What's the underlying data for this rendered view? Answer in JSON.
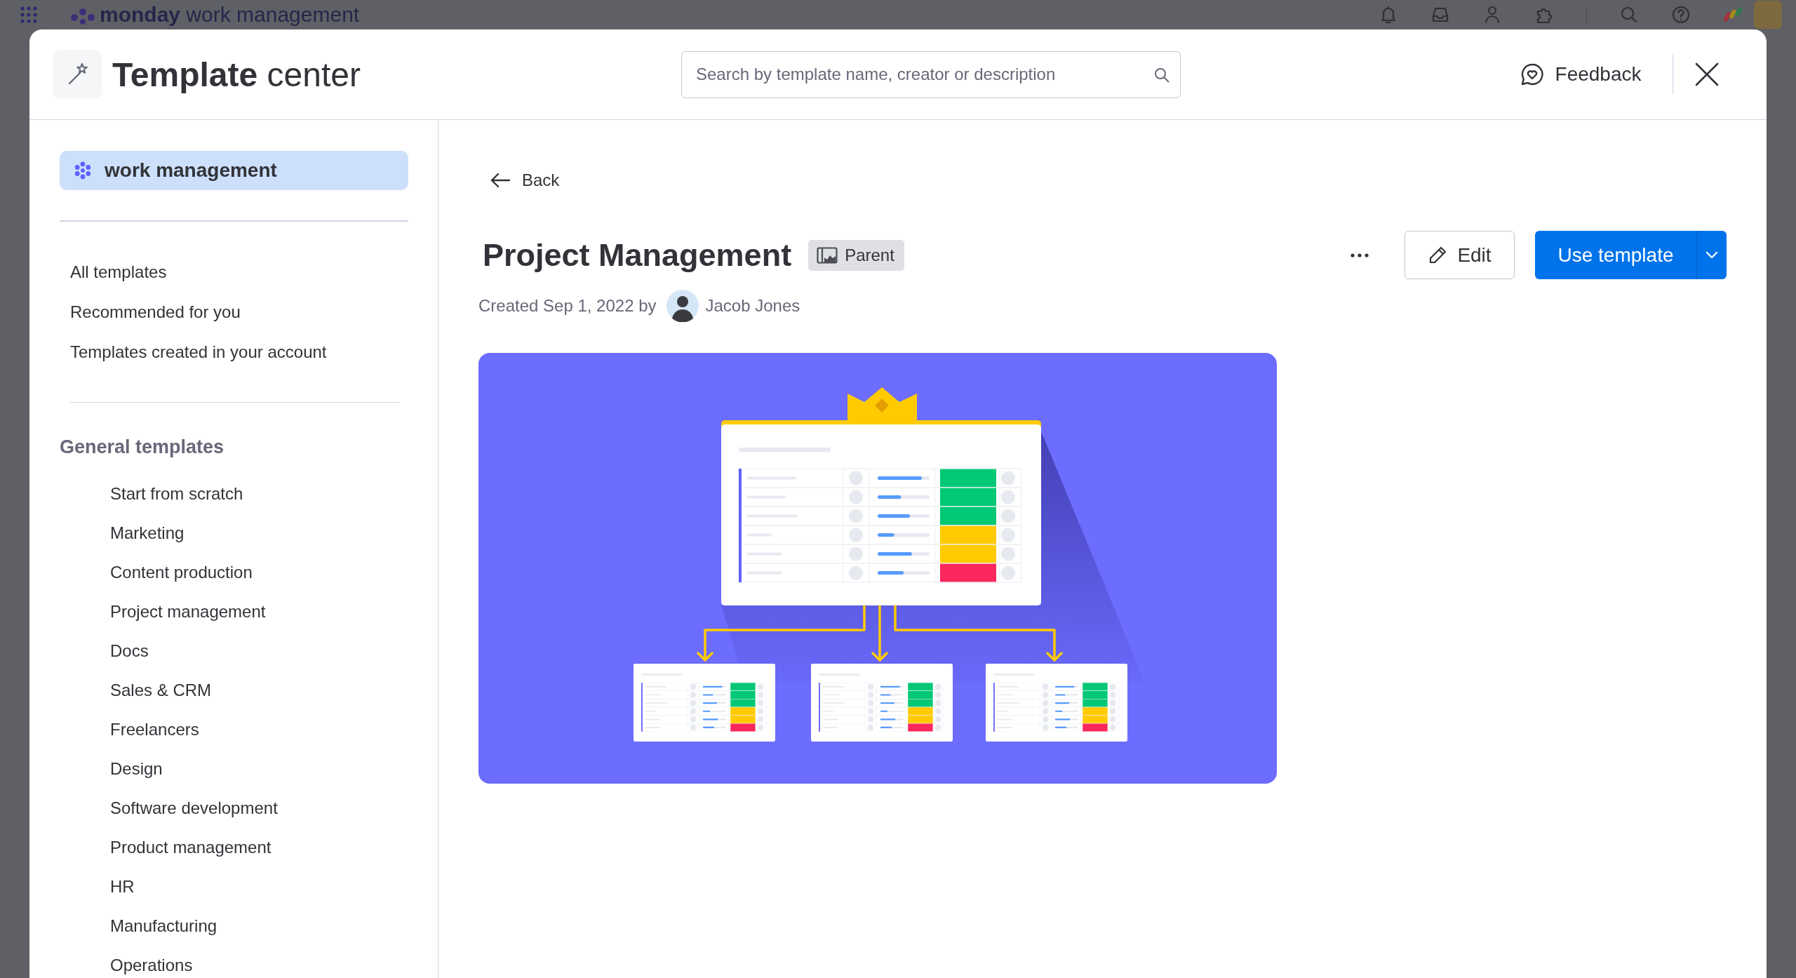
{
  "app_bar": {
    "title": "**monday** work management"
  },
  "modal": {
    "title": "**Template** center",
    "search": {
      "placeholder": "Search by template name, creator or description"
    },
    "feedback": "Feedback"
  },
  "sidebar": {
    "product": "work management",
    "links": [
      {
        "label": "All templates"
      },
      {
        "label": "Recommended for you"
      },
      {
        "label": "Templates created in your account"
      }
    ],
    "section": {
      "title": "General templates",
      "items": [
        {
          "label": "Start from scratch"
        },
        {
          "label": "Marketing"
        },
        {
          "label": "Content production"
        },
        {
          "label": "Project management"
        },
        {
          "label": "Docs"
        },
        {
          "label": "Sales & CRM"
        },
        {
          "label": "Freelancers"
        },
        {
          "label": "Design"
        },
        {
          "label": "Software development"
        },
        {
          "label": "Product management"
        },
        {
          "label": "HR"
        },
        {
          "label": "Manufacturing"
        },
        {
          "label": "Operations"
        }
      ]
    }
  },
  "template": {
    "back": "Back",
    "title": "Project Management",
    "badge": "Parent",
    "created": "Created Sep 1, 2022 by",
    "author": "Jacob Jones",
    "edit": "Edit",
    "primary_action": "Use template"
  }
}
